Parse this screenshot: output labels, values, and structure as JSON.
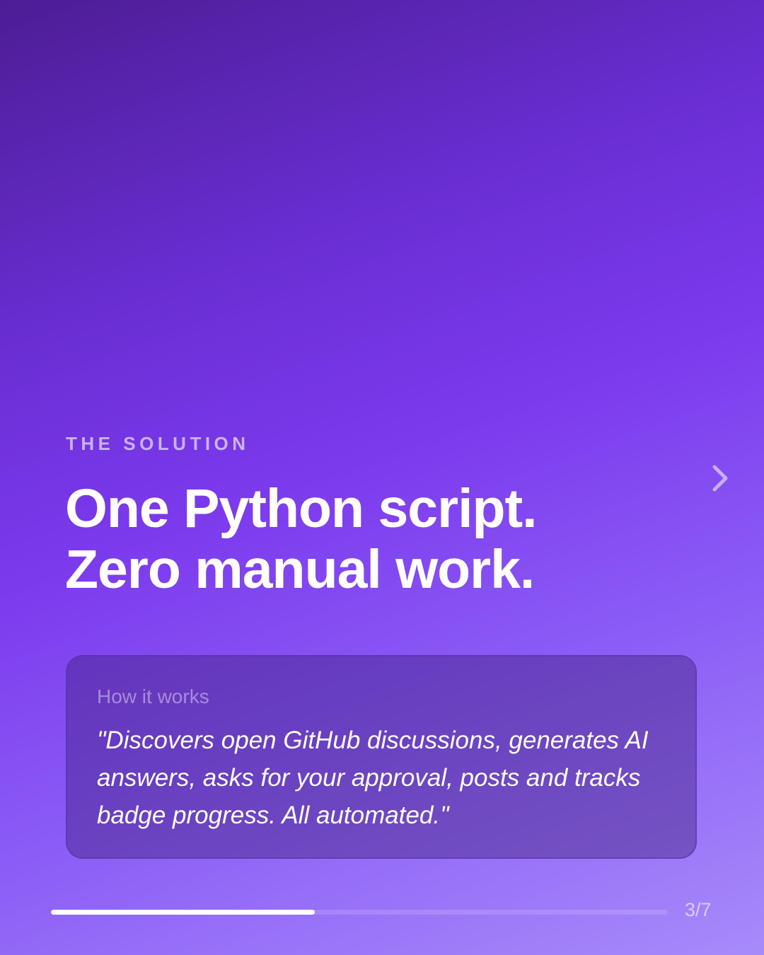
{
  "slide": {
    "eyebrow": "THE SOLUTION",
    "headline": {
      "line1": "One Python script.",
      "line2": "Zero manual work."
    },
    "card": {
      "label": "How it works",
      "quote": "\"Discovers open GitHub discussions, generates AI answers, asks for your approval, posts and tracks badge progress. All automated.\""
    },
    "next_icon": "chevron-right-icon"
  },
  "pagination": {
    "current": 3,
    "total": 7,
    "label": "3/7",
    "progress_fraction": 0.428
  },
  "colors": {
    "gradient_start": "#4c1d95",
    "gradient_mid": "#7c3aed",
    "gradient_end": "#a78bfa",
    "text": "#ffffff"
  }
}
